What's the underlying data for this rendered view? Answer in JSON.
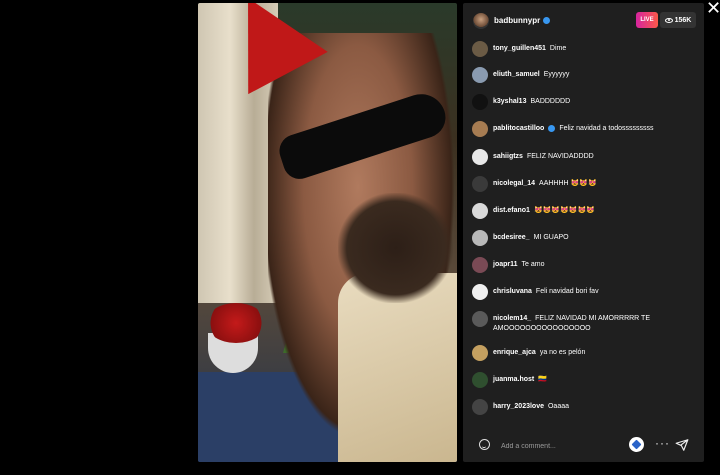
{
  "header": {
    "host_name": "badbunnypr",
    "live_label": "LIVE",
    "viewer_count": "156K"
  },
  "comments": [
    {
      "user": "tony_guillen451",
      "text": "Dime",
      "avatar_color": "#6b5b45"
    },
    {
      "user": "eliuth_samuel",
      "text": "Eyyyyyy",
      "avatar_color": "#8a9bb0"
    },
    {
      "user": "k3yshal13",
      "text": "BADDDDDD",
      "avatar_color": "#111111"
    },
    {
      "user": "pablitocastilloo",
      "text": "Feliz navidad a todosssssssss",
      "avatar_color": "#a67c52",
      "verified": true
    },
    {
      "user": "sahiigtzs",
      "text": "FELIZ NAVIDADDDD",
      "avatar_color": "#e8e8e8"
    },
    {
      "user": "nicolegal_14",
      "text": "AAHHHH 😻😻😻",
      "avatar_color": "#3a3a3a"
    },
    {
      "user": "dist.efano1",
      "text": "😻😻😻😻😻😻😻",
      "avatar_color": "#d9d9d9"
    },
    {
      "user": "bcdesiree_",
      "text": "MI GUAPO",
      "avatar_color": "#b8b8b8"
    },
    {
      "user": "joapr11",
      "text": "Te amo",
      "avatar_color": "#7a4a55"
    },
    {
      "user": "chrisluvana",
      "text": "Feli navidad bori fav",
      "avatar_color": "#efefef"
    },
    {
      "user": "nicolem14_",
      "text": "FELIZ NAVIDAD MI AMORRRRR TE AMOOOOOOOOOOOOOOOO",
      "avatar_color": "#5a5a5a"
    },
    {
      "user": "enrique_ajca",
      "text": "ya no es pelón",
      "avatar_color": "#c4a060"
    },
    {
      "user": "juanma.host",
      "text": "🇨🇴",
      "avatar_color": "#2f4f2f"
    },
    {
      "user": "harry_2023love",
      "text": "Oaaaa",
      "avatar_color": "#444444"
    }
  ],
  "footer": {
    "comment_placeholder": "Add a comment...",
    "more_label": "···"
  },
  "close_label": "✕"
}
